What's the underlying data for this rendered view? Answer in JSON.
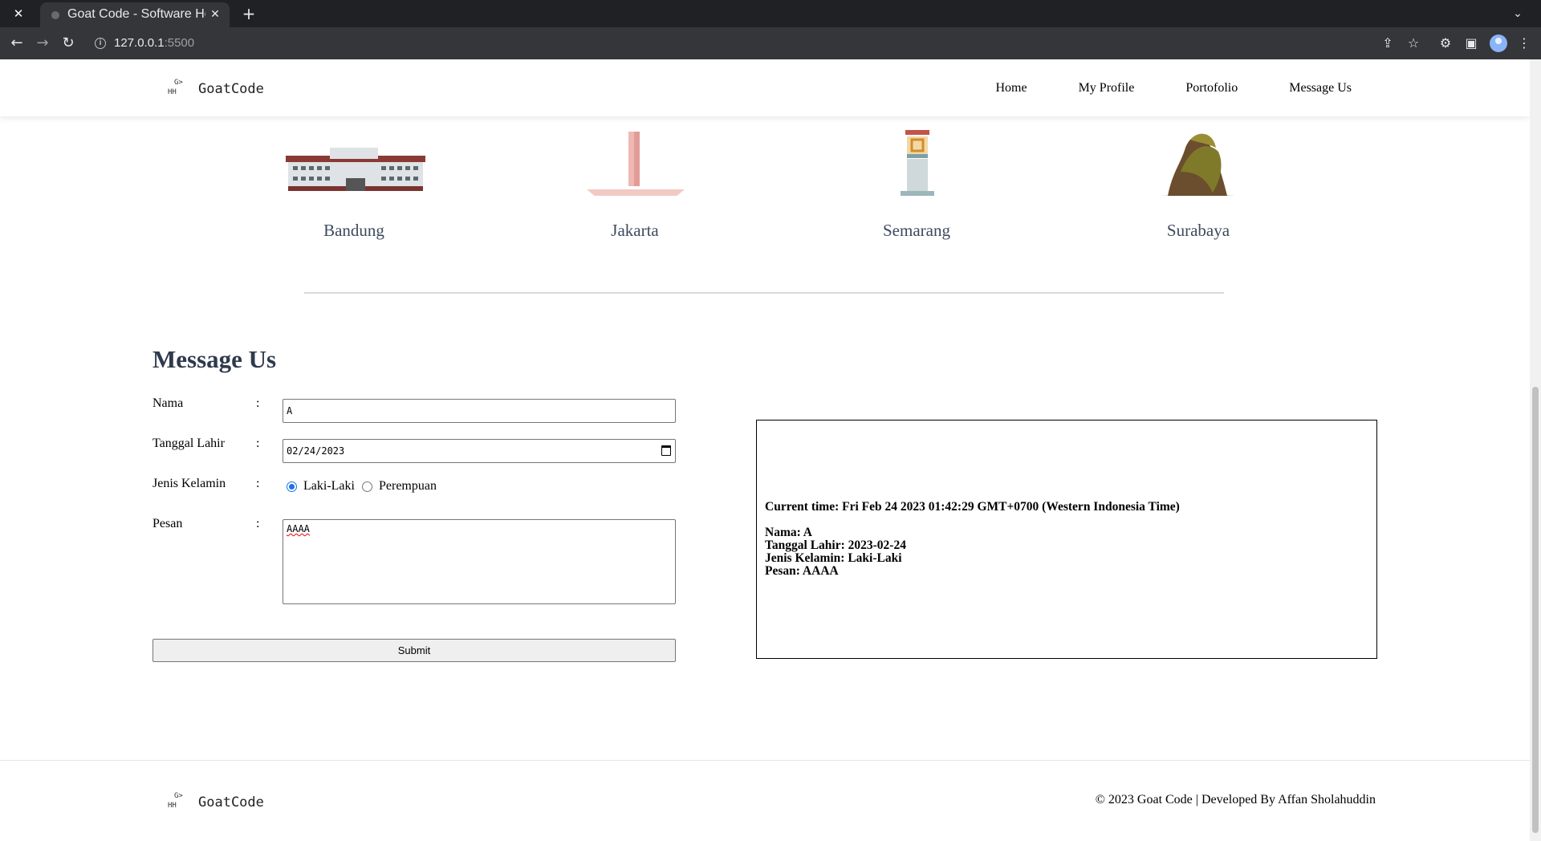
{
  "browser": {
    "tab_title": "Goat Code - Software House",
    "url_host": "127.0.0.1",
    "url_port": ":5500"
  },
  "header": {
    "logo_text": "GoatCode",
    "nav": [
      "Home",
      "My Profile",
      "Portofolio",
      "Message Us"
    ]
  },
  "cities": [
    "Bandung",
    "Jakarta",
    "Semarang",
    "Surabaya"
  ],
  "message": {
    "title": "Message Us",
    "labels": {
      "nama": "Nama",
      "tanggal": "Tanggal Lahir",
      "jenis": "Jenis Kelamin",
      "pesan": "Pesan"
    },
    "colon": ":",
    "values": {
      "nama": "A",
      "tanggal": "02/24/2023",
      "pesan": "AAAA"
    },
    "radio_options": [
      "Laki-Laki",
      "Perempuan"
    ],
    "radio_selected": "Laki-Laki",
    "submit_label": "Submit"
  },
  "result": {
    "current_time": "Current time: Fri Feb 24 2023 01:42:29 GMT+0700 (Western Indonesia Time)",
    "nama": "Nama: A",
    "tanggal": "Tanggal Lahir: 2023-02-24",
    "jenis": "Jenis Kelamin: Laki-Laki",
    "pesan": "Pesan: AAAA"
  },
  "footer": {
    "logo_text": "GoatCode",
    "copyright": "© 2023 Goat Code | Developed By Affan Sholahuddin"
  },
  "colors": {
    "city_label": "#3d4a5c",
    "title": "#2f3a4d",
    "radio_accent": "#1a73e8"
  }
}
